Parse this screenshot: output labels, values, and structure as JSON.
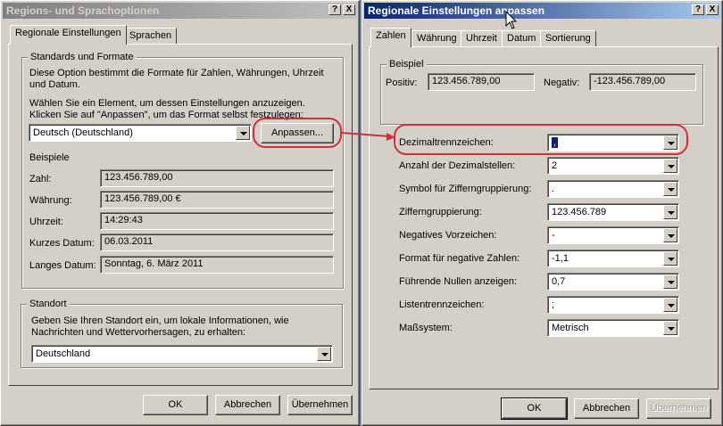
{
  "left_dialog": {
    "title": "Regions- und Sprachoptionen",
    "help_button": "?",
    "close_button": "X",
    "tabs": [
      "Regionale Einstellungen",
      "Sprachen"
    ],
    "standards_group": {
      "label": "Standards und Formate",
      "description": "Diese Option bestimmt die Formate für Zahlen, Währungen, Uhrzeit und Datum.",
      "instruction": "Wählen Sie ein Element, um dessen Einstellungen anzuzeigen. Klicken Sie auf \"Anpassen\", um das Format selbst festzulegen:",
      "locale_value": "Deutsch (Deutschland)",
      "customize_button": "Anpassen..."
    },
    "examples": {
      "label": "Beispiele",
      "rows": [
        {
          "label": "Zahl:",
          "value": "123.456.789,00"
        },
        {
          "label": "Währung:",
          "value": "123.456.789,00 €"
        },
        {
          "label": "Uhrzeit:",
          "value": "14:29:43"
        },
        {
          "label": "Kurzes Datum:",
          "value": "06.03.2011"
        },
        {
          "label": "Langes Datum:",
          "value": "Sonntag, 6. März 2011"
        }
      ]
    },
    "location_group": {
      "label": "Standort",
      "description": "Geben Sie Ihren Standort ein, um lokale Informationen, wie Nachrichten und Wettervorhersagen, zu erhalten:",
      "value": "Deutschland"
    },
    "buttons": {
      "ok": "OK",
      "cancel": "Abbrechen",
      "apply": "Übernehmen"
    }
  },
  "right_dialog": {
    "title": "Regionale Einstellungen anpassen",
    "help_button": "?",
    "close_button": "X",
    "tabs": [
      "Zahlen",
      "Währung",
      "Uhrzeit",
      "Datum",
      "Sortierung"
    ],
    "example_group": {
      "label": "Beispiel",
      "positive_label": "Positiv:",
      "positive_value": "123.456.789,00",
      "negative_label": "Negativ:",
      "negative_value": "-123.456.789,00"
    },
    "settings": [
      {
        "label": "Dezimaltrennzeichen:",
        "value": ","
      },
      {
        "label": "Anzahl der Dezimalstellen:",
        "value": "2"
      },
      {
        "label": "Symbol für Zifferngruppierung:",
        "value": "."
      },
      {
        "label": "Zifferngruppierung:",
        "value": "123.456.789"
      },
      {
        "label": "Negatives Vorzeichen:",
        "value": "-"
      },
      {
        "label": "Format für negative Zahlen:",
        "value": "-1,1"
      },
      {
        "label": "Führende Nullen anzeigen:",
        "value": "0,7"
      },
      {
        "label": "Listentrennzeichen:",
        "value": ";"
      },
      {
        "label": "Maßsystem:",
        "value": "Metrisch"
      }
    ],
    "buttons": {
      "ok": "OK",
      "cancel": "Abbrechen",
      "apply": "Übernehmen"
    }
  },
  "colors": {
    "annotation": "#d0303c",
    "active_title": "#0a246a",
    "dialog_face": "#d4d0c8"
  }
}
